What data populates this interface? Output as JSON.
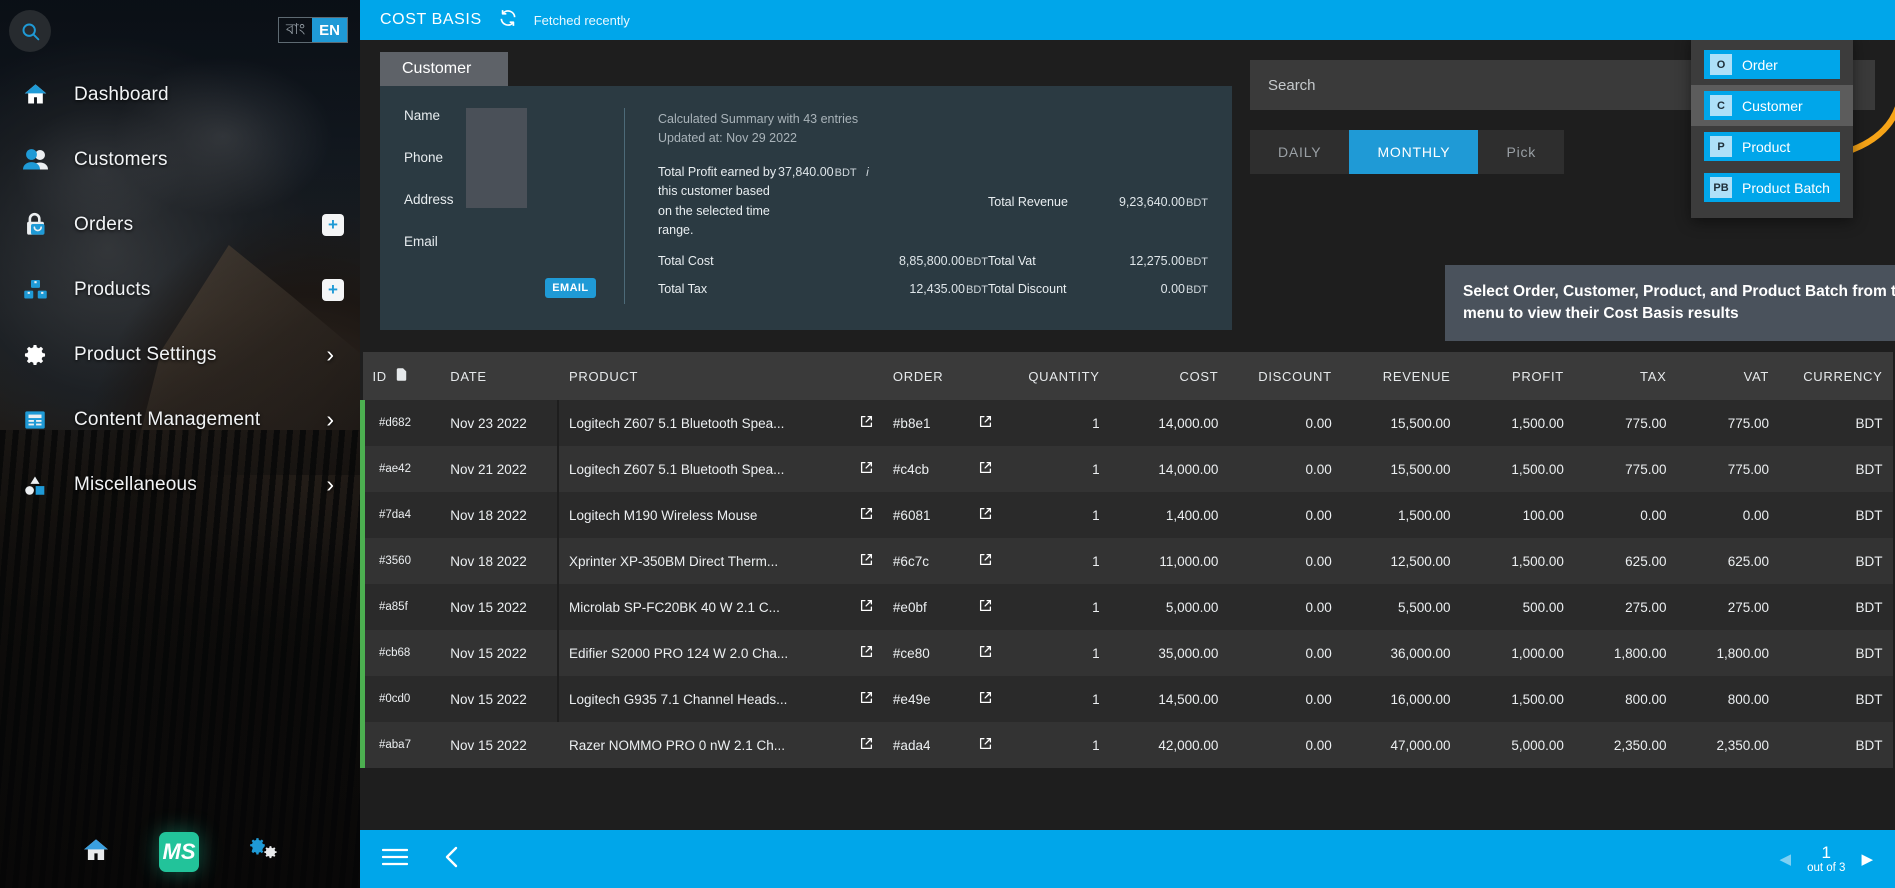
{
  "sidebar": {
    "search_icon": "search-icon",
    "lang": {
      "alt": "বাং",
      "current": "EN"
    },
    "items": [
      {
        "label": "Dashboard",
        "icon": "home-icon",
        "chevron": "",
        "plus": ""
      },
      {
        "label": "Customers",
        "icon": "users-icon",
        "chevron": "",
        "plus": ""
      },
      {
        "label": "Orders",
        "icon": "bag-icon",
        "chevron": "",
        "plus": "+"
      },
      {
        "label": "Products",
        "icon": "boxes-icon",
        "chevron": "",
        "plus": "+"
      },
      {
        "label": "Product Settings",
        "icon": "gear-icon",
        "chevron": "›",
        "plus": ""
      },
      {
        "label": "Content Management",
        "icon": "document-icon",
        "chevron": "›",
        "plus": ""
      },
      {
        "label": "Miscellaneous",
        "icon": "shapes-icon",
        "chevron": "›",
        "plus": ""
      }
    ],
    "footer": {
      "home": "home-icon",
      "logo": "MS",
      "settings": "gears-icon"
    }
  },
  "topbar": {
    "title": "COST BASIS",
    "refresh_icon": "refresh-icon",
    "fetched": "Fetched recently"
  },
  "customer_card": {
    "tab_label": "Customer",
    "fields": [
      "Name",
      "Phone",
      "Address",
      "Email"
    ],
    "email_badge": "EMAIL"
  },
  "summary": {
    "entries_line": "Calculated Summary with 43 entries",
    "updated_line": "Updated at: Nov 29 2022",
    "profit_label": "Total Profit earned by this customer based on the selected time range.",
    "profit_value": "37,840.00",
    "info_icon": "info-icon",
    "currency": "BDT",
    "items": [
      {
        "label": "Total Revenue",
        "value": "9,23,640.00",
        "unit": "BDT"
      },
      {
        "label": "Total Cost",
        "value": "8,85,800.00",
        "unit": "BDT"
      },
      {
        "label": "Total Vat",
        "value": "12,275.00",
        "unit": "BDT"
      },
      {
        "label": "Total Tax",
        "value": "12,435.00",
        "unit": "BDT"
      },
      {
        "label": "Total Discount",
        "value": "0.00",
        "unit": "BDT"
      }
    ]
  },
  "search": {
    "placeholder": "Search",
    "value": ""
  },
  "range_tabs": [
    {
      "label": "DAILY",
      "active": false
    },
    {
      "label": "MONTHLY",
      "active": true
    },
    {
      "label": "Pick",
      "active": false
    }
  ],
  "dropdown": {
    "items": [
      {
        "key": "O",
        "label": "Order",
        "selected": false
      },
      {
        "key": "C",
        "label": "Customer",
        "selected": true
      },
      {
        "key": "P",
        "label": "Product",
        "selected": false
      },
      {
        "key": "PB",
        "label": "Product Batch",
        "selected": false
      }
    ]
  },
  "annotation": {
    "text": "Select Order, Customer, Product, and Product Batch from the drop down menu to view their Cost Basis results",
    "arrow_color": "#f6a417"
  },
  "table": {
    "columns": [
      "ID",
      "DATE",
      "PRODUCT",
      "ORDER",
      "QUANTITY",
      "COST",
      "DISCOUNT",
      "REVENUE",
      "PROFIT",
      "TAX",
      "VAT",
      "CURRENCY"
    ],
    "id_copy_icon": "copy-icon",
    "rows": [
      {
        "id": "#d682",
        "date": "Nov 23 2022",
        "product": "Logitech Z607 5.1 Bluetooth Spea...",
        "order": "#b8e1",
        "quantity": "1",
        "cost": "14,000.00",
        "discount": "0.00",
        "revenue": "15,500.00",
        "profit": "1,500.00",
        "tax": "775.00",
        "vat": "775.00",
        "currency": "BDT"
      },
      {
        "id": "#ae42",
        "date": "Nov 21 2022",
        "product": "Logitech Z607 5.1 Bluetooth Spea...",
        "order": "#c4cb",
        "quantity": "1",
        "cost": "14,000.00",
        "discount": "0.00",
        "revenue": "15,500.00",
        "profit": "1,500.00",
        "tax": "775.00",
        "vat": "775.00",
        "currency": "BDT"
      },
      {
        "id": "#7da4",
        "date": "Nov 18 2022",
        "product": "Logitech M190 Wireless Mouse",
        "order": "#6081",
        "quantity": "1",
        "cost": "1,400.00",
        "discount": "0.00",
        "revenue": "1,500.00",
        "profit": "100.00",
        "tax": "0.00",
        "vat": "0.00",
        "currency": "BDT"
      },
      {
        "id": "#3560",
        "date": "Nov 18 2022",
        "product": "Xprinter XP-350BM Direct Therm...",
        "order": "#6c7c",
        "quantity": "1",
        "cost": "11,000.00",
        "discount": "0.00",
        "revenue": "12,500.00",
        "profit": "1,500.00",
        "tax": "625.00",
        "vat": "625.00",
        "currency": "BDT"
      },
      {
        "id": "#a85f",
        "date": "Nov 15 2022",
        "product": "Microlab SP-FC20BK 40 W 2.1 C...",
        "order": "#e0bf",
        "quantity": "1",
        "cost": "5,000.00",
        "discount": "0.00",
        "revenue": "5,500.00",
        "profit": "500.00",
        "tax": "275.00",
        "vat": "275.00",
        "currency": "BDT"
      },
      {
        "id": "#cb68",
        "date": "Nov 15 2022",
        "product": "Edifier S2000 PRO 124 W 2.0 Cha...",
        "order": "#ce80",
        "quantity": "1",
        "cost": "35,000.00",
        "discount": "0.00",
        "revenue": "36,000.00",
        "profit": "1,000.00",
        "tax": "1,800.00",
        "vat": "1,800.00",
        "currency": "BDT"
      },
      {
        "id": "#0cd0",
        "date": "Nov 15 2022",
        "product": "Logitech G935 7.1 Channel Heads...",
        "order": "#e49e",
        "quantity": "1",
        "cost": "14,500.00",
        "discount": "0.00",
        "revenue": "16,000.00",
        "profit": "1,500.00",
        "tax": "800.00",
        "vat": "800.00",
        "currency": "BDT"
      },
      {
        "id": "#aba7",
        "date": "Nov 15 2022",
        "product": "Razer NOMMO PRO 0 nW 2.1 Ch...",
        "order": "#ada4",
        "quantity": "1",
        "cost": "42,000.00",
        "discount": "0.00",
        "revenue": "47,000.00",
        "profit": "5,000.00",
        "tax": "2,350.00",
        "vat": "2,350.00",
        "currency": "BDT"
      }
    ]
  },
  "bottombar": {
    "menu_icon": "hamburger-icon",
    "back_icon": "chevron-left-icon",
    "pager": {
      "prev": "◀",
      "next": "▶",
      "page": "1",
      "total_text": "out of 3"
    }
  }
}
